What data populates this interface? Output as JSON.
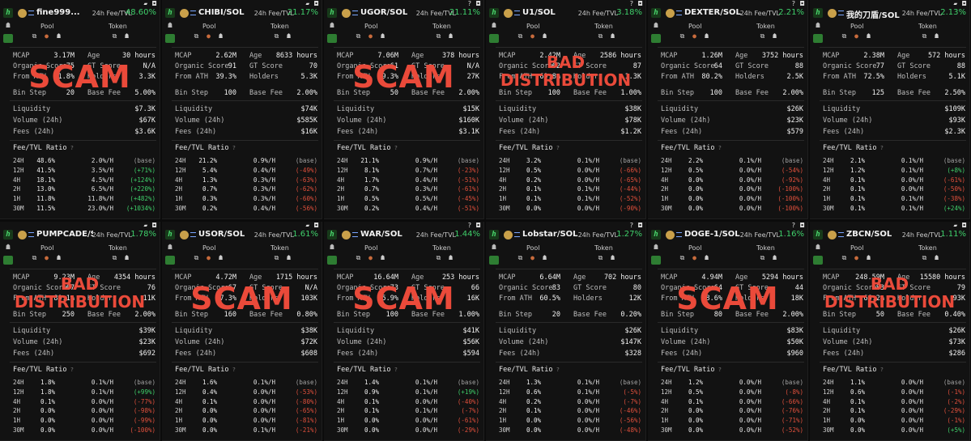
{
  "header_labels": {
    "fee_tvl": "24h Fee/TVL",
    "pool": "Pool",
    "token": "Token"
  },
  "metric_labels": {
    "mcap": "MCAP",
    "age": "Age",
    "organic": "Organic Score",
    "gt": "GT Score",
    "ath": "From ATH",
    "holders": "Holders",
    "binstep": "Bin Step",
    "basefee": "Base Fee",
    "liq": "Liquidity",
    "vol": "Volume (24h)",
    "fees": "Fees (24h)"
  },
  "fee_ratio_title": "Fee/TVL Ratio",
  "colors": {
    "green": "#3fcf6a",
    "red": "#e0503c",
    "overlay": "#ea4a3a",
    "bg": "#121212"
  },
  "icons": [
    "camera-icon",
    "pill-icon",
    "question-icon",
    "globe-icon",
    "twitter-icon",
    "copy-icon",
    "bot-icon"
  ],
  "cards": [
    {
      "pair": "fine999...",
      "fee": "48.60%",
      "mcap": "3.17M",
      "age": "30 hours",
      "organic": "75",
      "gt": "N/A",
      "ath": "61.8%",
      "holders": "3.3K",
      "binstep": "20",
      "basefee": "5.00%",
      "liq": "$7.3K",
      "vol": "$67K",
      "fees": "$3.6K",
      "overlay": "SCAM",
      "ratios": [
        [
          "24H",
          "48.6%",
          "2.0%/H",
          "(base)"
        ],
        [
          "12H",
          "41.5%",
          "3.5%/H",
          "(+71%)"
        ],
        [
          "4H",
          "18.1%",
          "4.5%/H",
          "(+124%)"
        ],
        [
          "2H",
          "13.0%",
          "6.5%/H",
          "(+220%)"
        ],
        [
          "1H",
          "11.8%",
          "11.8%/H",
          "(+482%)"
        ],
        [
          "30M",
          "11.5%",
          "23.0%/H",
          "(+1034%)"
        ]
      ]
    },
    {
      "pair": "CHIBI/SOL",
      "fee": "21.17%",
      "mcap": "2.62M",
      "age": "8633 hours",
      "organic": "91",
      "gt": "70",
      "ath": "39.3%",
      "holders": "5.3K",
      "binstep": "100",
      "basefee": "2.00%",
      "liq": "$74K",
      "vol": "$585K",
      "fees": "$16K",
      "overlay": "",
      "ratios": [
        [
          "24H",
          "21.2%",
          "0.9%/H",
          "(base)"
        ],
        [
          "12H",
          "5.4%",
          "0.4%/H",
          "(-49%)"
        ],
        [
          "4H",
          "1.3%",
          "0.3%/H",
          "(-63%)"
        ],
        [
          "2H",
          "0.7%",
          "0.3%/H",
          "(-62%)"
        ],
        [
          "1H",
          "0.3%",
          "0.3%/H",
          "(-60%)"
        ],
        [
          "30M",
          "0.2%",
          "0.4%/H",
          "(-56%)"
        ]
      ]
    },
    {
      "pair": "UGOR/SOL",
      "fee": "21.11%",
      "mcap": "7.06M",
      "age": "378 hours",
      "organic": "61",
      "gt": "N/A",
      "ath": "69.3%",
      "holders": "27K",
      "binstep": "50",
      "basefee": "2.00%",
      "liq": "$15K",
      "vol": "$160K",
      "fees": "$3.1K",
      "overlay": "SCAM",
      "ratios": [
        [
          "24H",
          "21.1%",
          "0.9%/H",
          "(base)"
        ],
        [
          "12H",
          "8.1%",
          "0.7%/H",
          "(-23%)"
        ],
        [
          "4H",
          "1.7%",
          "0.4%/H",
          "(-51%)"
        ],
        [
          "2H",
          "0.7%",
          "0.3%/H",
          "(-61%)"
        ],
        [
          "1H",
          "0.5%",
          "0.5%/H",
          "(-45%)"
        ],
        [
          "30M",
          "0.2%",
          "0.4%/H",
          "(-51%)"
        ]
      ]
    },
    {
      "pair": "U1/SOL",
      "fee": "3.18%",
      "mcap": "2.42M",
      "age": "2586 hours",
      "organic": "62",
      "gt": "87",
      "ath": "69.8%",
      "holders": "1.3K",
      "binstep": "100",
      "basefee": "1.00%",
      "liq": "$38K",
      "vol": "$78K",
      "fees": "$1.2K",
      "overlay": "BAD DISTRIBUTION",
      "ratios": [
        [
          "24H",
          "3.2%",
          "0.1%/H",
          "(base)"
        ],
        [
          "12H",
          "0.5%",
          "0.0%/H",
          "(-66%)"
        ],
        [
          "4H",
          "0.2%",
          "0.0%/H",
          "(-65%)"
        ],
        [
          "2H",
          "0.1%",
          "0.1%/H",
          "(-44%)"
        ],
        [
          "1H",
          "0.1%",
          "0.1%/H",
          "(-52%)"
        ],
        [
          "30M",
          "0.0%",
          "0.0%/H",
          "(-90%)"
        ]
      ]
    },
    {
      "pair": "DEXTER/SOL",
      "fee": "2.21%",
      "mcap": "1.26M",
      "age": "3752 hours",
      "organic": "64",
      "gt": "88",
      "ath": "80.2%",
      "holders": "2.5K",
      "binstep": "100",
      "basefee": "2.00%",
      "liq": "$26K",
      "vol": "$23K",
      "fees": "$579",
      "overlay": "",
      "ratios": [
        [
          "24H",
          "2.2%",
          "0.1%/H",
          "(base)"
        ],
        [
          "12H",
          "0.5%",
          "0.0%/H",
          "(-54%)"
        ],
        [
          "4H",
          "0.0%",
          "0.0%/H",
          "(-92%)"
        ],
        [
          "2H",
          "0.0%",
          "0.0%/H",
          "(-100%)"
        ],
        [
          "1H",
          "0.0%",
          "0.0%/H",
          "(-100%)"
        ],
        [
          "30M",
          "0.0%",
          "0.0%/H",
          "(-100%)"
        ]
      ]
    },
    {
      "pair": "我的刀盾/SOL",
      "fee": "2.13%",
      "mcap": "2.38M",
      "age": "572 hours",
      "organic": "77",
      "gt": "88",
      "ath": "72.5%",
      "holders": "5.1K",
      "binstep": "125",
      "basefee": "2.50%",
      "liq": "$109K",
      "vol": "$93K",
      "fees": "$2.3K",
      "overlay": "",
      "ratios": [
        [
          "24H",
          "2.1%",
          "0.1%/H",
          "(base)"
        ],
        [
          "12H",
          "1.2%",
          "0.1%/H",
          "(+8%)"
        ],
        [
          "4H",
          "0.1%",
          "0.0%/H",
          "(-61%)"
        ],
        [
          "2H",
          "0.1%",
          "0.0%/H",
          "(-50%)"
        ],
        [
          "1H",
          "0.1%",
          "0.1%/H",
          "(-38%)"
        ],
        [
          "30M",
          "0.1%",
          "0.1%/H",
          "(+24%)"
        ]
      ]
    },
    {
      "pair": "PUMPCADE/S...",
      "fee": "1.78%",
      "mcap": "9.23M",
      "age": "4354 hours",
      "organic": "67",
      "gt": "76",
      "ath": "80.1%",
      "holders": "11K",
      "binstep": "250",
      "basefee": "2.00%",
      "liq": "$39K",
      "vol": "$23K",
      "fees": "$692",
      "overlay": "BAD DISTRIBUTION",
      "ratios": [
        [
          "24H",
          "1.8%",
          "0.1%/H",
          "(base)"
        ],
        [
          "12H",
          "1.8%",
          "0.1%/H",
          "(+99%)"
        ],
        [
          "4H",
          "0.1%",
          "0.0%/H",
          "(-77%)"
        ],
        [
          "2H",
          "0.0%",
          "0.0%/H",
          "(-98%)"
        ],
        [
          "1H",
          "0.0%",
          "0.0%/H",
          "(-99%)"
        ],
        [
          "30M",
          "0.0%",
          "0.0%/H",
          "(-100%)"
        ]
      ]
    },
    {
      "pair": "USOR/SOL",
      "fee": "1.61%",
      "mcap": "4.72M",
      "age": "1715 hours",
      "organic": "67",
      "gt": "N/A",
      "ath": "97.3%",
      "holders": "103K",
      "binstep": "160",
      "basefee": "0.80%",
      "liq": "$38K",
      "vol": "$72K",
      "fees": "$608",
      "overlay": "SCAM",
      "ratios": [
        [
          "24H",
          "1.6%",
          "0.1%/H",
          "(base)"
        ],
        [
          "12H",
          "0.4%",
          "0.0%/H",
          "(-53%)"
        ],
        [
          "4H",
          "0.1%",
          "0.0%/H",
          "(-80%)"
        ],
        [
          "2H",
          "0.0%",
          "0.0%/H",
          "(-65%)"
        ],
        [
          "1H",
          "0.0%",
          "0.0%/H",
          "(-81%)"
        ],
        [
          "30M",
          "0.0%",
          "0.1%/H",
          "(-21%)"
        ]
      ]
    },
    {
      "pair": "WAR/SOL",
      "fee": "1.44%",
      "mcap": "16.64M",
      "age": "253 hours",
      "organic": "73",
      "gt": "66",
      "ath": "65.9%",
      "holders": "16K",
      "binstep": "100",
      "basefee": "1.00%",
      "liq": "$41K",
      "vol": "$56K",
      "fees": "$594",
      "overlay": "SCAM",
      "ratios": [
        [
          "24H",
          "1.4%",
          "0.1%/H",
          "(base)"
        ],
        [
          "12H",
          "0.9%",
          "0.1%/H",
          "(+19%)"
        ],
        [
          "4H",
          "0.1%",
          "0.0%/H",
          "(-40%)"
        ],
        [
          "2H",
          "0.1%",
          "0.1%/H",
          "(-7%)"
        ],
        [
          "1H",
          "0.0%",
          "0.0%/H",
          "(-61%)"
        ],
        [
          "30M",
          "0.0%",
          "0.0%/H",
          "(-29%)"
        ]
      ]
    },
    {
      "pair": "Lobstar/SOL",
      "fee": "1.27%",
      "mcap": "6.64M",
      "age": "702 hours",
      "organic": "83",
      "gt": "80",
      "ath": "60.5%",
      "holders": "12K",
      "binstep": "20",
      "basefee": "0.20%",
      "liq": "$26K",
      "vol": "$147K",
      "fees": "$328",
      "overlay": "",
      "ratios": [
        [
          "24H",
          "1.3%",
          "0.1%/H",
          "(base)"
        ],
        [
          "12H",
          "0.6%",
          "0.1%/H",
          "(-5%)"
        ],
        [
          "4H",
          "0.2%",
          "0.0%/H",
          "(-7%)"
        ],
        [
          "2H",
          "0.1%",
          "0.0%/H",
          "(-46%)"
        ],
        [
          "1H",
          "0.0%",
          "0.0%/H",
          "(-56%)"
        ],
        [
          "30M",
          "0.0%",
          "0.0%/H",
          "(-48%)"
        ]
      ]
    },
    {
      "pair": "DOGE-1/SOL",
      "fee": "1.16%",
      "mcap": "4.94M",
      "age": "5294 hours",
      "organic": "64",
      "gt": "44",
      "ath": "88.6%",
      "holders": "18K",
      "binstep": "80",
      "basefee": "2.00%",
      "liq": "$83K",
      "vol": "$50K",
      "fees": "$960",
      "overlay": "SCAM",
      "ratios": [
        [
          "24H",
          "1.2%",
          "0.0%/H",
          "(base)"
        ],
        [
          "12H",
          "0.5%",
          "0.0%/H",
          "(-8%)"
        ],
        [
          "4H",
          "0.1%",
          "0.0%/H",
          "(-66%)"
        ],
        [
          "2H",
          "0.0%",
          "0.0%/H",
          "(-76%)"
        ],
        [
          "1H",
          "0.0%",
          "0.0%/H",
          "(-71%)"
        ],
        [
          "30M",
          "0.0%",
          "0.0%/H",
          "(-52%)"
        ]
      ]
    },
    {
      "pair": "ZBCN/SOL",
      "fee": "1.11%",
      "mcap": "248.59M",
      "age": "15580 hours",
      "organic": "83",
      "gt": "79",
      "ath": "66.2%",
      "holders": "93K",
      "binstep": "50",
      "basefee": "0.40%",
      "liq": "$26K",
      "vol": "$73K",
      "fees": "$286",
      "overlay": "BAD DISTRIBUTION",
      "ratios": [
        [
          "24H",
          "1.1%",
          "0.0%/H",
          "(base)"
        ],
        [
          "12H",
          "0.6%",
          "0.0%/H",
          "(-1%)"
        ],
        [
          "4H",
          "0.1%",
          "0.0%/H",
          "(-2%)"
        ],
        [
          "2H",
          "0.1%",
          "0.0%/H",
          "(-29%)"
        ],
        [
          "1H",
          "0.0%",
          "0.0%/H",
          "(-1%)"
        ],
        [
          "30M",
          "0.0%",
          "0.0%/H",
          "(+5%)"
        ]
      ]
    }
  ]
}
